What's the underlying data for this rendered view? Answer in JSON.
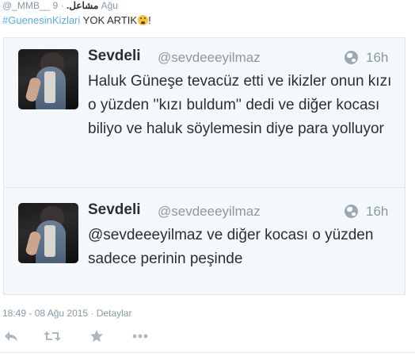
{
  "header": {
    "handle": "@_MMB__",
    "display_name": "مشاعل.",
    "separator": "·",
    "date": "9 Ağu"
  },
  "tweet": {
    "hashtag": "#GuenesinKizlari",
    "text": " YOK ARTIK",
    "trailing": "!",
    "emoji_icon": "fearful-face-icon"
  },
  "quotes": [
    {
      "name": "Sevdeli",
      "handle": "@sevdeeeyilmaz",
      "time": "16h",
      "body": "Haluk Güneşe tevacüz etti ve ikizler onun kızı o yüzden ''kızı buldum'' dedi ve diğer kocası biliyo ve haluk söylemesin diye para yolluyor"
    },
    {
      "name": "Sevdeli",
      "handle": "@sevdeeeyilmaz",
      "time": "16h",
      "body": "@sevdeeeyilmaz ve diğer kocası o yüzden sadece perinin peşinde"
    }
  ],
  "meta": {
    "timestamp": "18:49 - 08 Ağu 2015",
    "separator": "·",
    "details_link": "Detaylar"
  },
  "actions": [
    "reply-icon",
    "retweet-icon",
    "favorite-star-icon",
    "more-dots-icon"
  ],
  "colors": {
    "hashtag": "#55acee",
    "muted": "#8899a6",
    "text": "#292f33",
    "card_bg": "#f5f8fa",
    "icon_gray": "#aab8c2"
  }
}
